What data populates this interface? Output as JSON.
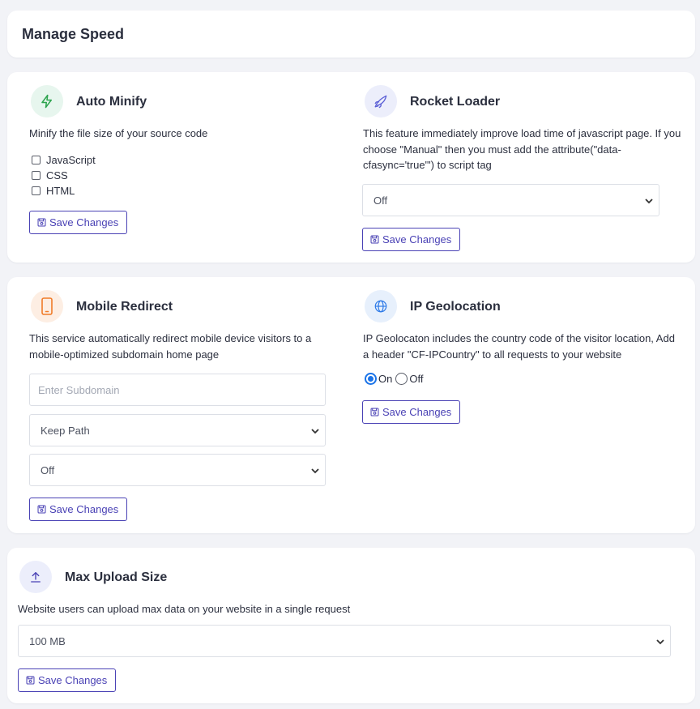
{
  "header": {
    "title": "Manage Speed"
  },
  "auto_minify": {
    "title": "Auto Minify",
    "description": "Minify the file size of your source code",
    "options": [
      {
        "label": "JavaScript",
        "checked": false
      },
      {
        "label": "CSS",
        "checked": false
      },
      {
        "label": "HTML",
        "checked": false
      }
    ],
    "button_label": "Save Changes",
    "icon": "bolt-icon",
    "icon_color": "#2ea44f",
    "icon_bg": "#e7f6ee"
  },
  "rocket_loader": {
    "title": "Rocket Loader",
    "description": "This feature immediately improve load time of javascript page. If you choose \"Manual\" then you must add the attribute(\"data-cfasync='true'\") to script tag",
    "select_value": "Off",
    "button_label": "Save Changes",
    "icon": "rocket-icon",
    "icon_color": "#5b5fd6",
    "icon_bg": "#eceefb"
  },
  "mobile_redirect": {
    "title": "Mobile Redirect",
    "description": "This service automatically redirect mobile device visitors to a mobile-optimized subdomain home page",
    "subdomain_placeholder": "Enter Subdomain",
    "path_select_value": "Keep Path",
    "status_select_value": "Off",
    "button_label": "Save Changes",
    "icon": "mobile-phone-icon",
    "icon_color": "#f07b28",
    "icon_bg": "#fdeee3"
  },
  "ip_geolocation": {
    "title": "IP Geolocation",
    "description": "IP Geolocaton includes the country code of the visitor location, Add a header \"CF-IPCountry\" to all requests to your website",
    "radio_on_label": "On",
    "radio_off_label": "Off",
    "selected": "On",
    "button_label": "Save Changes",
    "icon": "globe-icon",
    "icon_color": "#2f7be8",
    "icon_bg": "#e7f0fc"
  },
  "max_upload": {
    "title": "Max Upload Size",
    "description": "Website users can upload max data on your website in a single request",
    "select_value": "100 MB",
    "button_label": "Save Changes",
    "icon": "upload-icon",
    "icon_color": "#4a42b5",
    "icon_bg": "#eceefb"
  },
  "colors": {
    "accent": "#4a42b5",
    "radio_selected": "#1a73e8",
    "page_bg": "#f2f3f7"
  }
}
